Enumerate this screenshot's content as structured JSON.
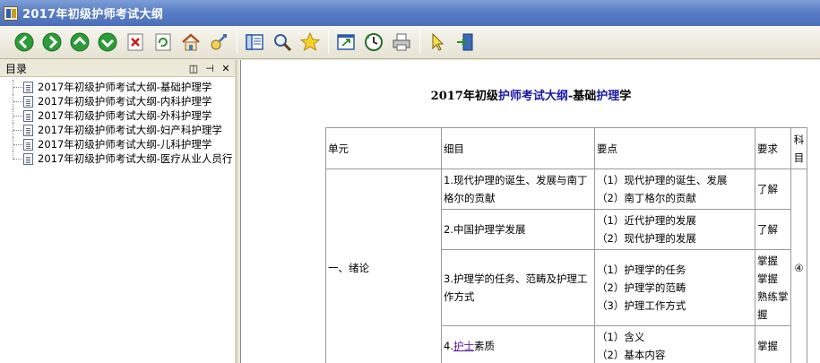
{
  "window": {
    "title": "2017年初级护师考试大纲"
  },
  "toolbar": {
    "buttons": [
      "back-icon",
      "forward-icon",
      "up-icon",
      "down-icon",
      "stop-icon",
      "refresh-icon",
      "home-icon",
      "sync-icon",
      "toc-icon",
      "search-icon",
      "favorites-icon",
      "resize-icon",
      "history-icon",
      "print-icon",
      "pointer-icon",
      "exit-icon"
    ]
  },
  "sidebar": {
    "title": "目录",
    "items": [
      {
        "label": "2017年初级护师考试大纲-基础护理学"
      },
      {
        "label": "2017年初级护师考试大纲-内科护理学"
      },
      {
        "label": "2017年初级护师考试大纲-外科护理学"
      },
      {
        "label": "2017年初级护师考试大纲-妇产科护理学"
      },
      {
        "label": "2017年初级护师考试大纲-儿科护理学"
      },
      {
        "label": "2017年初级护师考试大纲-医疗从业人员行"
      }
    ]
  },
  "doc": {
    "title_a": "2017年初级",
    "title_b": "护师考试大纲",
    "title_c": "-基础",
    "title_d": "护理",
    "title_e": "学",
    "table": {
      "headers": [
        "单元",
        "细目",
        "要点",
        "要求",
        "科目"
      ],
      "unit": "一、绪论",
      "subject_mark": "④",
      "rows": [
        {
          "item": "1.现代护理的诞生、发展与南丁格尔的贡献",
          "points": [
            "（1）现代护理的诞生、发展",
            "（2）南丁格尔的贡献"
          ],
          "req": "了解"
        },
        {
          "item": "2.中国护理学发展",
          "points": [
            "（1）近代护理的发展",
            "（2）现代护理的发展"
          ],
          "req": "了解"
        },
        {
          "item": "3.护理学的任务、范畴及护理工作方式",
          "points": [
            "（1）护理学的任务",
            "（2）护理学的范畴",
            "（3）护理工作方式"
          ],
          "req": "掌握 掌握 熟练掌握"
        },
        {
          "item_prefix": "4.",
          "item_link": "护士",
          "item_suffix": "素质",
          "points": [
            "（1）含义",
            "（2）基本内容"
          ],
          "req": "掌握"
        }
      ]
    }
  }
}
